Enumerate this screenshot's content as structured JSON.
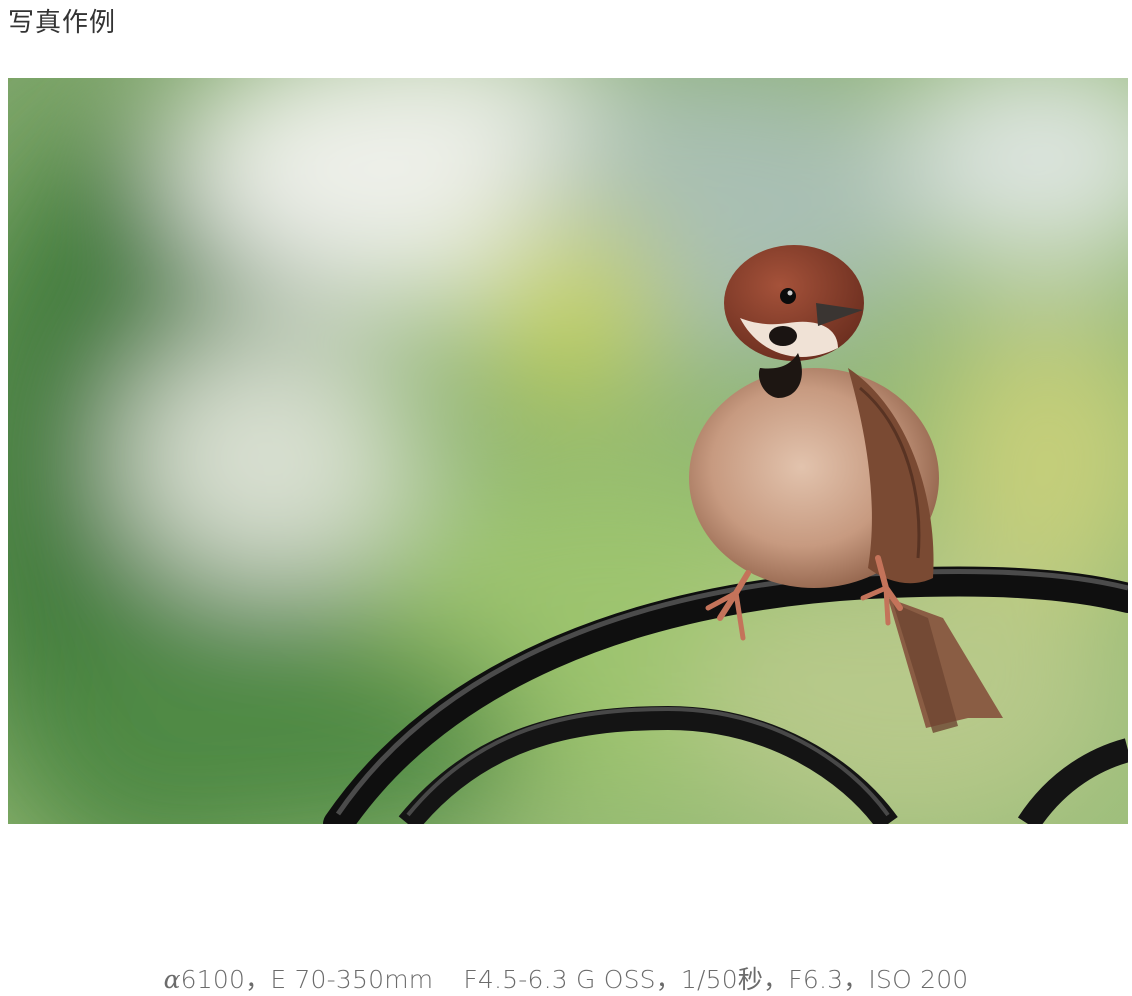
{
  "header": {
    "title": "写真作例"
  },
  "photo": {
    "subject": "sparrow-perched-on-iron-railing"
  },
  "caption": {
    "camera_symbol": "α",
    "camera_model": "6100",
    "sep1": "，",
    "lens": "E 70-350mm",
    "lens_spec": "F4.5-6.3 G OSS",
    "sep2": "，",
    "shutter": "1/50秒",
    "sep3": "，",
    "aperture": "F6.3",
    "sep4": "，",
    "iso": "ISO 200"
  },
  "colors": {
    "title_text": "#333333",
    "caption_text": "#6b6b6b",
    "background": "#ffffff"
  }
}
